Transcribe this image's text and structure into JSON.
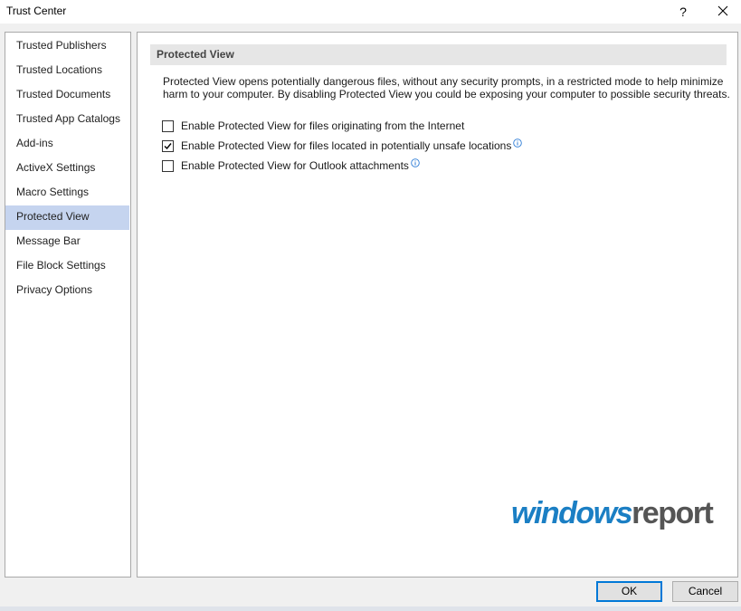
{
  "window": {
    "title": "Trust Center",
    "help_label": "?"
  },
  "sidebar": {
    "items": [
      {
        "label": "Trusted Publishers",
        "active": false
      },
      {
        "label": "Trusted Locations",
        "active": false
      },
      {
        "label": "Trusted Documents",
        "active": false
      },
      {
        "label": "Trusted App Catalogs",
        "active": false
      },
      {
        "label": "Add-ins",
        "active": false
      },
      {
        "label": "ActiveX Settings",
        "active": false
      },
      {
        "label": "Macro Settings",
        "active": false
      },
      {
        "label": "Protected View",
        "active": true
      },
      {
        "label": "Message Bar",
        "active": false
      },
      {
        "label": "File Block Settings",
        "active": false
      },
      {
        "label": "Privacy Options",
        "active": false
      }
    ]
  },
  "main": {
    "section_title": "Protected View",
    "description": "Protected View opens potentially dangerous files, without any security prompts, in a restricted mode to help minimize harm to your computer. By disabling Protected View you could be exposing your computer to possible security threats.",
    "options": [
      {
        "label": "Enable Protected View for files originating from the Internet",
        "checked": false,
        "info_icon": false
      },
      {
        "label": "Enable Protected View for files located in potentially unsafe locations",
        "checked": true,
        "info_icon": true
      },
      {
        "label": "Enable Protected View for Outlook attachments",
        "checked": false,
        "info_icon": true
      }
    ]
  },
  "watermark": {
    "part1": "windows",
    "part2": "report"
  },
  "footer": {
    "ok_label": "OK",
    "cancel_label": "Cancel"
  },
  "colors": {
    "active_item_bg": "#c5d4ef",
    "section_header_bg": "#e6e6e6",
    "default_button_border": "#0078d7",
    "watermark_blue": "#1b7fc4",
    "info_icon": "#2a7ad5"
  }
}
